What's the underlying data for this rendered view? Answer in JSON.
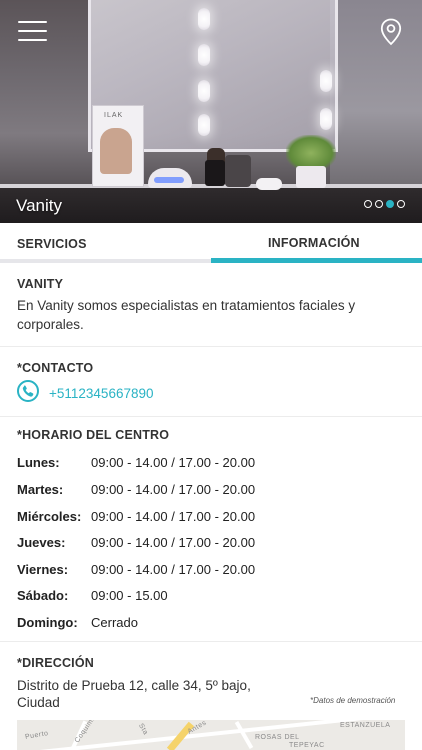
{
  "hero": {
    "title": "Vanity",
    "box_text": "ILAK",
    "slide_count": 4,
    "active_slide": 3
  },
  "tabs": [
    {
      "label": "SERVICIOS",
      "active": false
    },
    {
      "label": "INFORMACIÓN",
      "active": true
    }
  ],
  "about": {
    "title": "VANITY",
    "text": "En Vanity somos especialistas en tratamientos faciales y corporales."
  },
  "contact": {
    "title": "*CONTACTO",
    "phone": "+5112345667890"
  },
  "schedule": {
    "title": "*HORARIO DEL CENTRO",
    "rows": [
      {
        "day": "Lunes:",
        "hours": "09:00 - 14.00  /  17.00 - 20.00"
      },
      {
        "day": "Martes:",
        "hours": "09:00 - 14.00  /  17.00 - 20.00"
      },
      {
        "day": "Miércoles:",
        "hours": "09:00 - 14.00  /  17.00 - 20.00"
      },
      {
        "day": "Jueves:",
        "hours": "09:00 - 14.00  /  17.00 - 20.00"
      },
      {
        "day": "Viernes:",
        "hours": "09:00 - 14.00  /  17.00 - 20.00"
      },
      {
        "day": "Sábado:",
        "hours": "09:00 - 15.00"
      },
      {
        "day": "Domingo:",
        "hours": "Cerrado"
      }
    ]
  },
  "address": {
    "title": "*DIRECCIÓN",
    "line1": "Distrito de Prueba 12, calle 34, 5º bajo,",
    "line2": "Ciudad",
    "demo_note": "*Datos de demostración"
  },
  "map": {
    "labels": [
      "ESTANZUELA",
      "ROSAS DEL",
      "TEPEYAC",
      "Coquimbo",
      "Puerto",
      "Sta",
      "Antes"
    ]
  },
  "colors": {
    "accent": "#2ab3c4",
    "text": "#333333",
    "tab_inactive_bar": "#e6e6ea"
  },
  "icons": {
    "menu": "hamburger-icon",
    "location": "map-pin-icon",
    "phone": "phone-icon"
  }
}
